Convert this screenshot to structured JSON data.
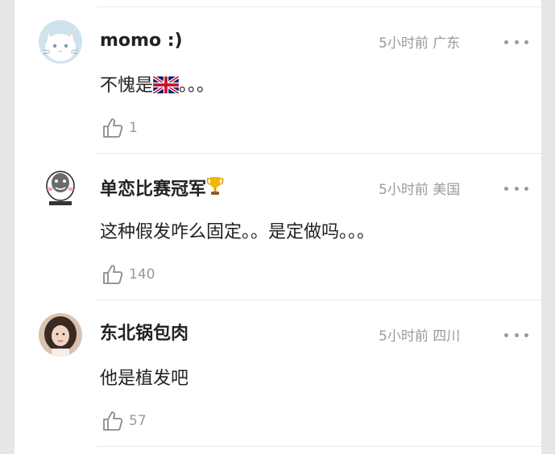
{
  "comments": [
    {
      "username": "momo :)",
      "time": "5小时前",
      "location": "广东",
      "text": "不愧是",
      "text_suffix": "。。。",
      "flag_icon": "uk-flag-emoji",
      "likes": "1",
      "avatar": "white-cat-avatar"
    },
    {
      "username": "单恋比赛冠军",
      "username_icon": "trophy-emoji",
      "time": "5小时前",
      "location": "美国",
      "text": "这种假发咋么固定。。是定做吗。。。",
      "likes": "140",
      "avatar": "meme-face-avatar"
    },
    {
      "username": "东北锅包肉",
      "time": "5小时前",
      "location": "四川",
      "text": "他是植发吧",
      "likes": "57",
      "avatar": "woman-portrait-avatar"
    }
  ],
  "colors": {
    "username": "#222222",
    "meta": "#9a9a9a",
    "background": "#e6e6e6",
    "panel": "#ffffff"
  }
}
